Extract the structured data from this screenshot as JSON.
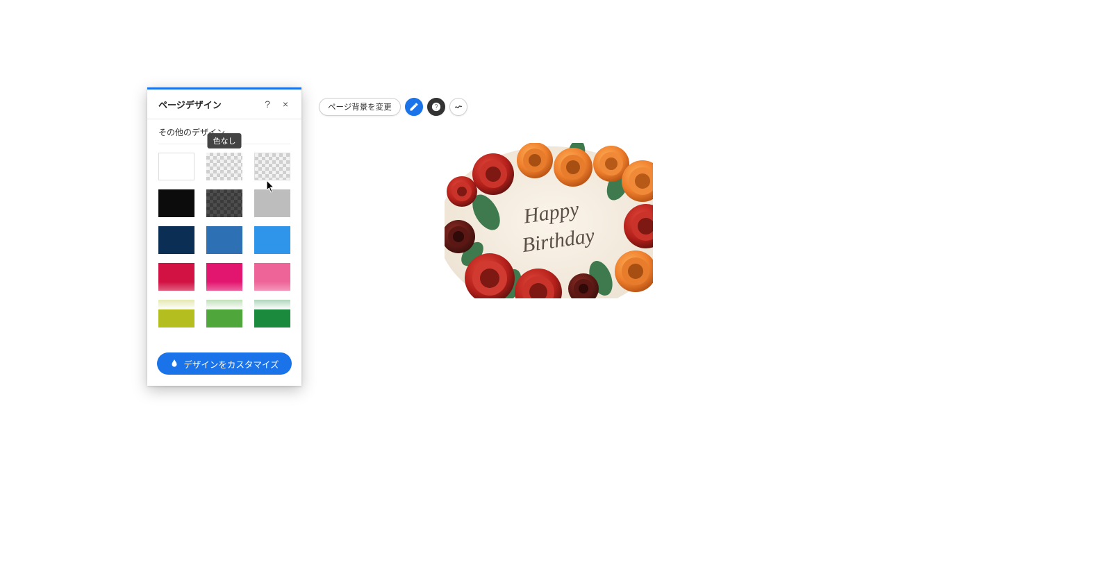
{
  "panel": {
    "title": "ページデザイン",
    "help_tooltip": "?",
    "close_tooltip": "×",
    "section_label": "その他のデザイン",
    "customize_label": "デザインをカスタマイズ",
    "swatches": [
      {
        "name": "white",
        "color": "#ffffff",
        "border": true,
        "checker": false,
        "dark": false,
        "tooltip": ""
      },
      {
        "name": "no-color-light",
        "color": "",
        "border": false,
        "checker": true,
        "dark": false,
        "tooltip": "色なし"
      },
      {
        "name": "no-color-light2",
        "color": "",
        "border": true,
        "checker": true,
        "dark": false,
        "tooltip": ""
      },
      {
        "name": "black",
        "color": "#0c0c0c",
        "border": false,
        "checker": false,
        "dark": false,
        "tooltip": ""
      },
      {
        "name": "no-color-dark",
        "color": "",
        "border": false,
        "checker": true,
        "dark": true,
        "tooltip": ""
      },
      {
        "name": "gray",
        "color": "#bdbdbd",
        "border": false,
        "checker": false,
        "dark": false,
        "tooltip": ""
      },
      {
        "name": "navy",
        "color": "#0b2e55",
        "border": false,
        "checker": false,
        "dark": false,
        "tooltip": ""
      },
      {
        "name": "blue",
        "color": "#2d70b4",
        "border": false,
        "checker": false,
        "dark": false,
        "tooltip": ""
      },
      {
        "name": "light-blue",
        "color": "#2e95eb",
        "border": false,
        "checker": false,
        "dark": false,
        "tooltip": ""
      },
      {
        "name": "crimson",
        "color": "#d11242",
        "border": false,
        "checker": false,
        "dark": false,
        "tooltip": ""
      },
      {
        "name": "magenta",
        "color": "#e3166f",
        "border": false,
        "checker": false,
        "dark": false,
        "tooltip": ""
      },
      {
        "name": "pink",
        "color": "#ef6498",
        "border": false,
        "checker": false,
        "dark": false,
        "tooltip": ""
      },
      {
        "name": "olive",
        "color": "#b4bf1f",
        "border": false,
        "checker": false,
        "dark": false,
        "tooltip": ""
      },
      {
        "name": "green",
        "color": "#4fa63a",
        "border": false,
        "checker": false,
        "dark": false,
        "tooltip": ""
      },
      {
        "name": "dark-green",
        "color": "#1b8a3d",
        "border": false,
        "checker": false,
        "dark": false,
        "tooltip": ""
      }
    ]
  },
  "toolbar": {
    "change_bg_label": "ページ背景を変更",
    "edit_name": "edit",
    "help_name": "help",
    "animation_name": "animation"
  },
  "canvas": {
    "image_text": "Happy Birthday",
    "image_alt": "decorated birthday cake with roses"
  }
}
